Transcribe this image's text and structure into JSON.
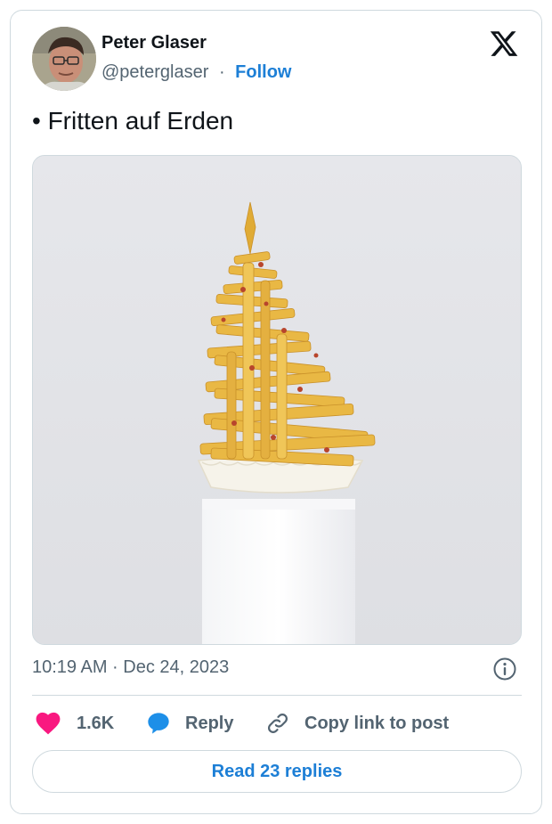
{
  "author": {
    "name": "Peter Glaser",
    "handle": "@peterglaser",
    "separator": "·",
    "follow_label": "Follow"
  },
  "tweet": {
    "text": "• Fritten auf Erden",
    "media_icon": "photo-fries-christmas-tree"
  },
  "meta": {
    "timestamp": "10:19 AM · Dec 24, 2023",
    "info_icon": "info-icon"
  },
  "actions": {
    "like_count": "1.6K",
    "reply_label": "Reply",
    "copy_label": "Copy link to post"
  },
  "footer": {
    "read_replies_label": "Read 23 replies"
  },
  "colors": {
    "accent": "#1d7fd6",
    "like": "#f91880",
    "text": "#0f1419",
    "muted": "#536471",
    "border": "#cfd9de"
  }
}
